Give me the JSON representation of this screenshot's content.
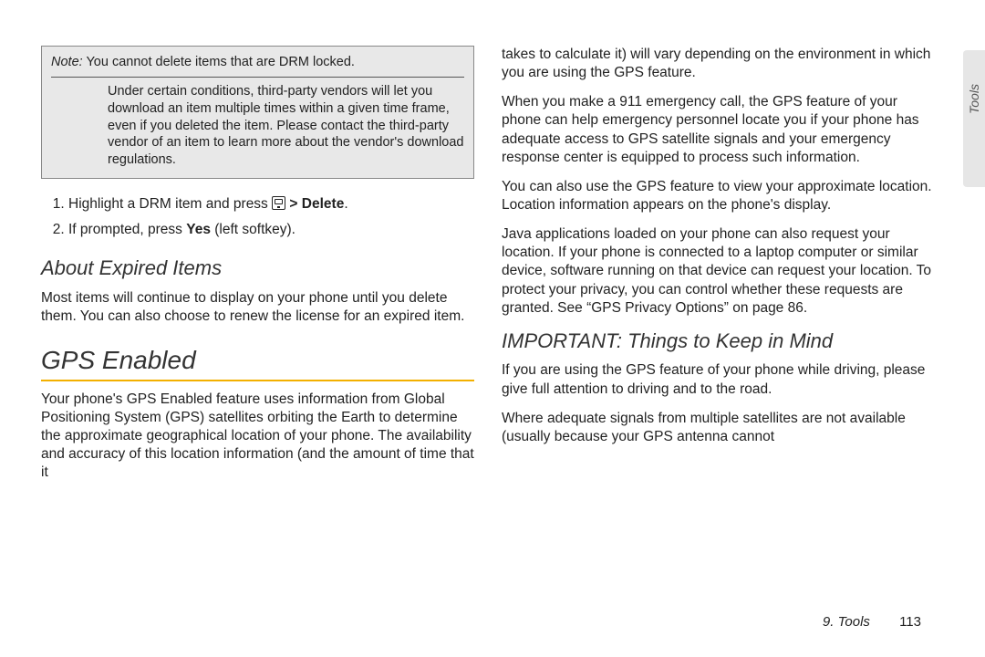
{
  "note": {
    "label": "Note:",
    "header_text": "You cannot delete items that are DRM locked.",
    "body": "Under certain conditions, third-party vendors will let you download an item multiple times within a given time frame, even if you deleted the item. Please contact the third-party vendor of an item to learn more about the vendor's download regulations."
  },
  "steps": {
    "s1_pre": "Highlight a DRM item and press ",
    "s1_gt": " > ",
    "s1_delete": "Delete",
    "s1_post": ".",
    "s2_pre": "If prompted, press ",
    "s2_yes": "Yes",
    "s2_post": " (left softkey)."
  },
  "about_heading": "About Expired Items",
  "about_body": "Most items will continue to display on your phone until you delete them. You can also choose to renew the license for an expired item.",
  "gps_heading": "GPS Enabled",
  "gps_p1": "Your phone's GPS Enabled feature uses information from Global Positioning System (GPS) satellites orbiting the Earth to determine the approximate geographical location of your phone. The availability and accuracy of this location information (and the amount of time that it",
  "right": {
    "p1": "takes to calculate it) will vary depending on the environment in which you are using the GPS feature.",
    "p2": "When you make a 911 emergency call, the GPS feature of your phone can help emergency personnel locate you if your phone has adequate access to GPS satellite signals and your emergency response center is equipped to process such information.",
    "p3": "You can also use the GPS feature to view your approximate location. Location information appears on the phone's display.",
    "p4": "Java applications loaded on your phone can also request your location. If your phone is connected to a laptop computer or similar device, software running on that device can request your location. To protect your privacy, you can control whether these requests are granted. See “GPS Privacy Options” on page 86.",
    "important_heading": "IMPORTANT: Things to Keep in Mind",
    "p5": "If you are using the GPS feature of your phone while driving, please give full attention to driving and to the road.",
    "p6": "Where adequate signals from multiple satellites are not available (usually because your GPS antenna cannot"
  },
  "tab_label": "Tools",
  "footer": {
    "chapter": "9. Tools",
    "page": "113"
  }
}
